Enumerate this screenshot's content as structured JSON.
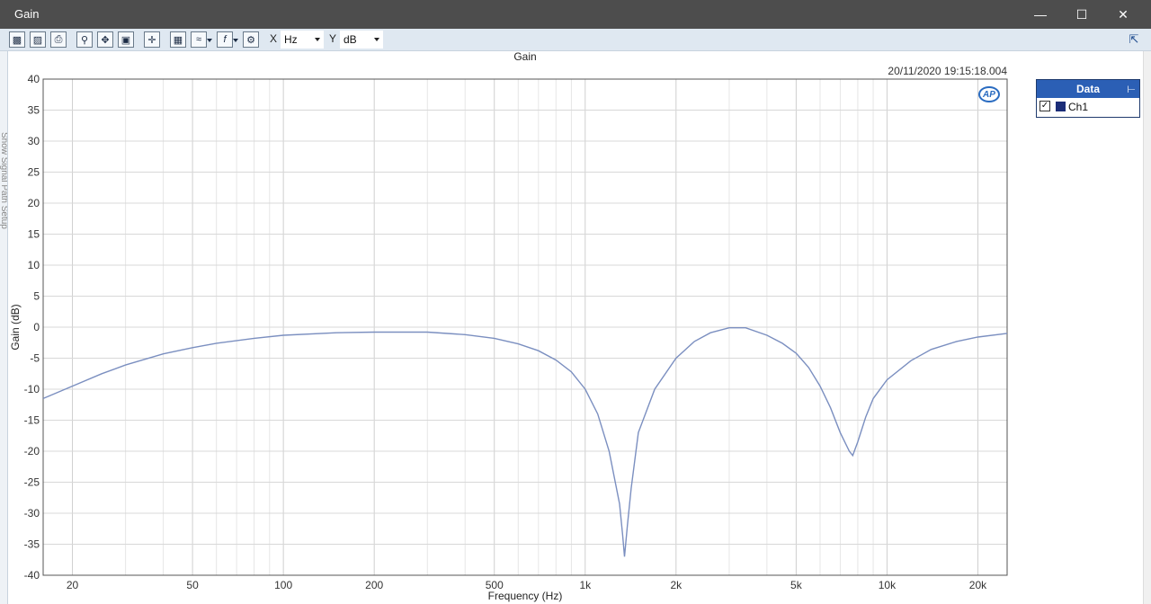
{
  "window": {
    "title": "Gain",
    "minimize_icon": "minimize-icon",
    "maximize_icon": "maximize-icon",
    "close_icon": "close-icon"
  },
  "toolbar": {
    "x_label": "X",
    "x_unit": "Hz",
    "y_label": "Y",
    "y_unit": "dB",
    "icons": [
      "save-icon",
      "save-as-icon",
      "print-icon",
      "zoom-icon",
      "pan-icon",
      "fit-icon",
      "cursor-icon",
      "table-icon",
      "graph-options-icon",
      "function-icon",
      "settings-icon"
    ],
    "undock_icon": "undock-icon"
  },
  "side_text": "Show Signal Path Setup",
  "plot": {
    "timestamp": "20/11/2020 19:15:18.004",
    "logo_text": "AP"
  },
  "legend": {
    "header": "Data",
    "items": [
      {
        "name": "Ch1",
        "checked": true,
        "color": "#1b2d78"
      }
    ]
  },
  "chart_data": {
    "type": "line",
    "title": "Gain",
    "xlabel": "Frequency (Hz)",
    "ylabel": "Gain (dB)",
    "x_scale": "log",
    "xlim": [
      16,
      25000
    ],
    "ylim": [
      -40,
      40
    ],
    "x_ticks": [
      20,
      50,
      100,
      200,
      500,
      1000,
      2000,
      5000,
      10000,
      20000
    ],
    "x_tick_labels": [
      "20",
      "50",
      "100",
      "200",
      "500",
      "1k",
      "2k",
      "5k",
      "10k",
      "20k"
    ],
    "y_ticks": [
      40,
      35,
      30,
      25,
      20,
      15,
      10,
      5,
      0,
      -5,
      -10,
      -15,
      -20,
      -25,
      -30,
      -35,
      -40
    ],
    "grid": true,
    "line_color": "#7b8fc0",
    "series": [
      {
        "name": "Ch1",
        "x": [
          16,
          20,
          25,
          30,
          40,
          50,
          60,
          80,
          100,
          150,
          200,
          300,
          400,
          500,
          600,
          700,
          800,
          900,
          1000,
          1100,
          1200,
          1300,
          1330,
          1350,
          1380,
          1420,
          1500,
          1700,
          2000,
          2300,
          2600,
          3000,
          3400,
          4000,
          4500,
          5000,
          5500,
          6000,
          6500,
          7000,
          7500,
          7700,
          8000,
          8500,
          9000,
          10000,
          12000,
          14000,
          17000,
          20000,
          25000
        ],
        "y": [
          -11.5,
          -9.5,
          -7.5,
          -6.1,
          -4.3,
          -3.3,
          -2.6,
          -1.8,
          -1.3,
          -0.9,
          -0.8,
          -0.8,
          -1.2,
          -1.8,
          -2.7,
          -3.8,
          -5.3,
          -7.2,
          -10.0,
          -14.0,
          -20.0,
          -28.5,
          -33.5,
          -37.0,
          -32.0,
          -26.0,
          -17.0,
          -10.0,
          -5.0,
          -2.3,
          -0.9,
          -0.1,
          -0.1,
          -1.3,
          -2.6,
          -4.2,
          -6.5,
          -9.5,
          -13.0,
          -17.0,
          -20.0,
          -20.7,
          -18.5,
          -14.5,
          -11.5,
          -8.5,
          -5.4,
          -3.6,
          -2.3,
          -1.6,
          -1.0
        ]
      }
    ]
  }
}
